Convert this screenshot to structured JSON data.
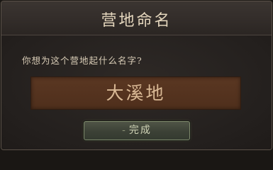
{
  "dialog": {
    "title": "营地命名",
    "prompt": "你想为这个营地起什么名字?",
    "name_input": {
      "value": "大溪地"
    },
    "done_button": {
      "dash": "-",
      "label": "完成"
    }
  }
}
